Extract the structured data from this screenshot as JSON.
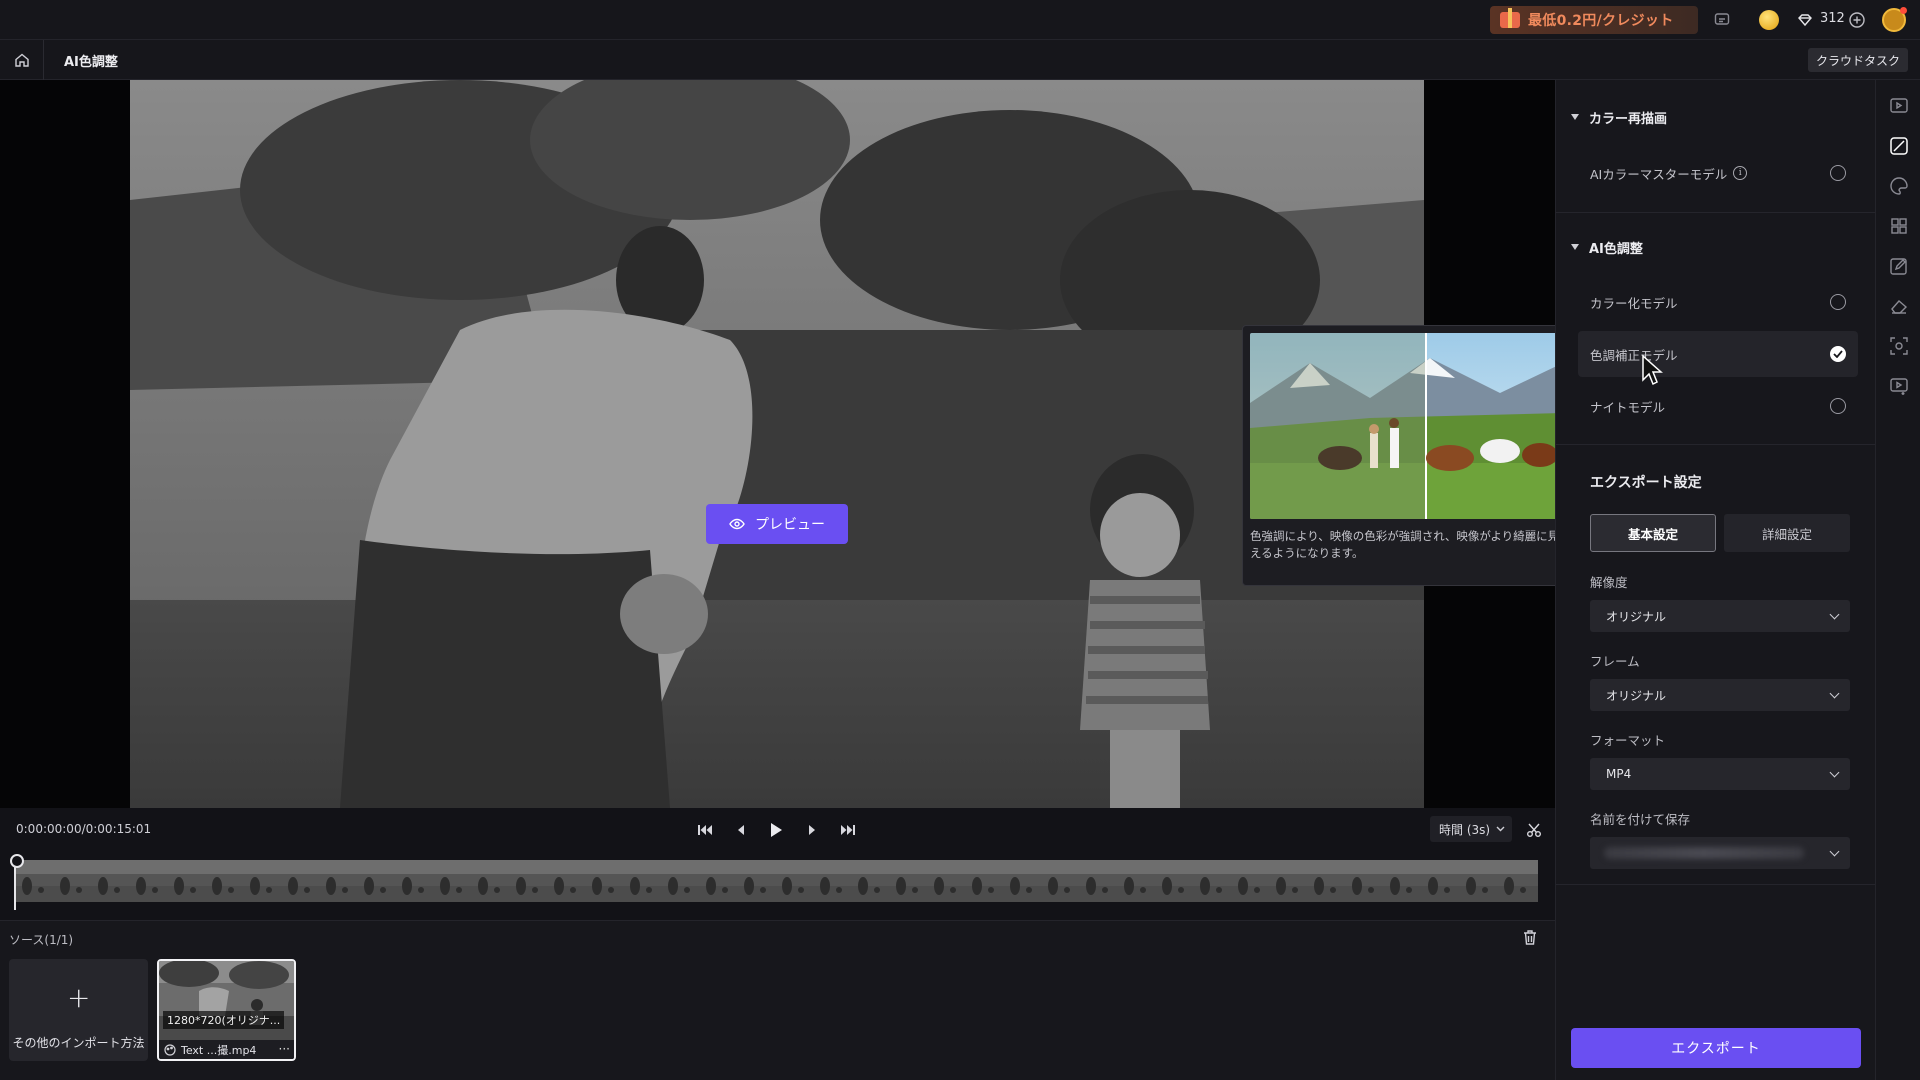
{
  "topbar": {
    "promo_text": "最低0.2円/クレジット",
    "credits": "312"
  },
  "tabbar": {
    "title": "AI色調整",
    "cloud_task": "クラウドタスク"
  },
  "viewer": {
    "preview_label": "プレビュー"
  },
  "tooltip": {
    "description": "色強調により、映像の色彩が強調され、映像がより綺麗に見えるようになります。"
  },
  "timeline": {
    "timecode": "0:00:00:00/0:00:15:01",
    "time_select": "時間 (3s)"
  },
  "source": {
    "title": "ソース(1/1)",
    "import_label": "その他のインポート方法",
    "clip_resolution": "1280*720(オリジナ...",
    "clip_name": "Text ...撮.mp4",
    "clip_more": "···"
  },
  "panel": {
    "recolor": {
      "title": "カラー再描画",
      "options": [
        {
          "label": "AIカラーマスターモデル",
          "selected": false
        }
      ]
    },
    "ai_color": {
      "title": "AI色調整",
      "options": [
        {
          "label": "カラー化モデル",
          "selected": false
        },
        {
          "label": "色調補正モデル",
          "selected": true
        },
        {
          "label": "ナイトモデル",
          "selected": false
        }
      ]
    },
    "export": {
      "title": "エクスポート設定",
      "tab_basic": "基本設定",
      "tab_detail": "詳細設定",
      "resolution_label": "解像度",
      "resolution_value": "オリジナル",
      "frame_label": "フレーム",
      "frame_value": "オリジナル",
      "format_label": "フォーマット",
      "format_value": "MP4",
      "save_as_label": "名前を付けて保存",
      "export_button": "エクスポート"
    }
  },
  "colors": {
    "accent": "#6a4ff2",
    "promo_text": "#f08a5d",
    "background": "#121217",
    "panel": "#17171c"
  },
  "icons": {
    "rail": [
      "preview-panel-icon",
      "color-adjust-icon",
      "palette-icon",
      "apps-icon",
      "edit-icon",
      "eraser-icon",
      "scan-icon",
      "video-add-icon"
    ]
  }
}
